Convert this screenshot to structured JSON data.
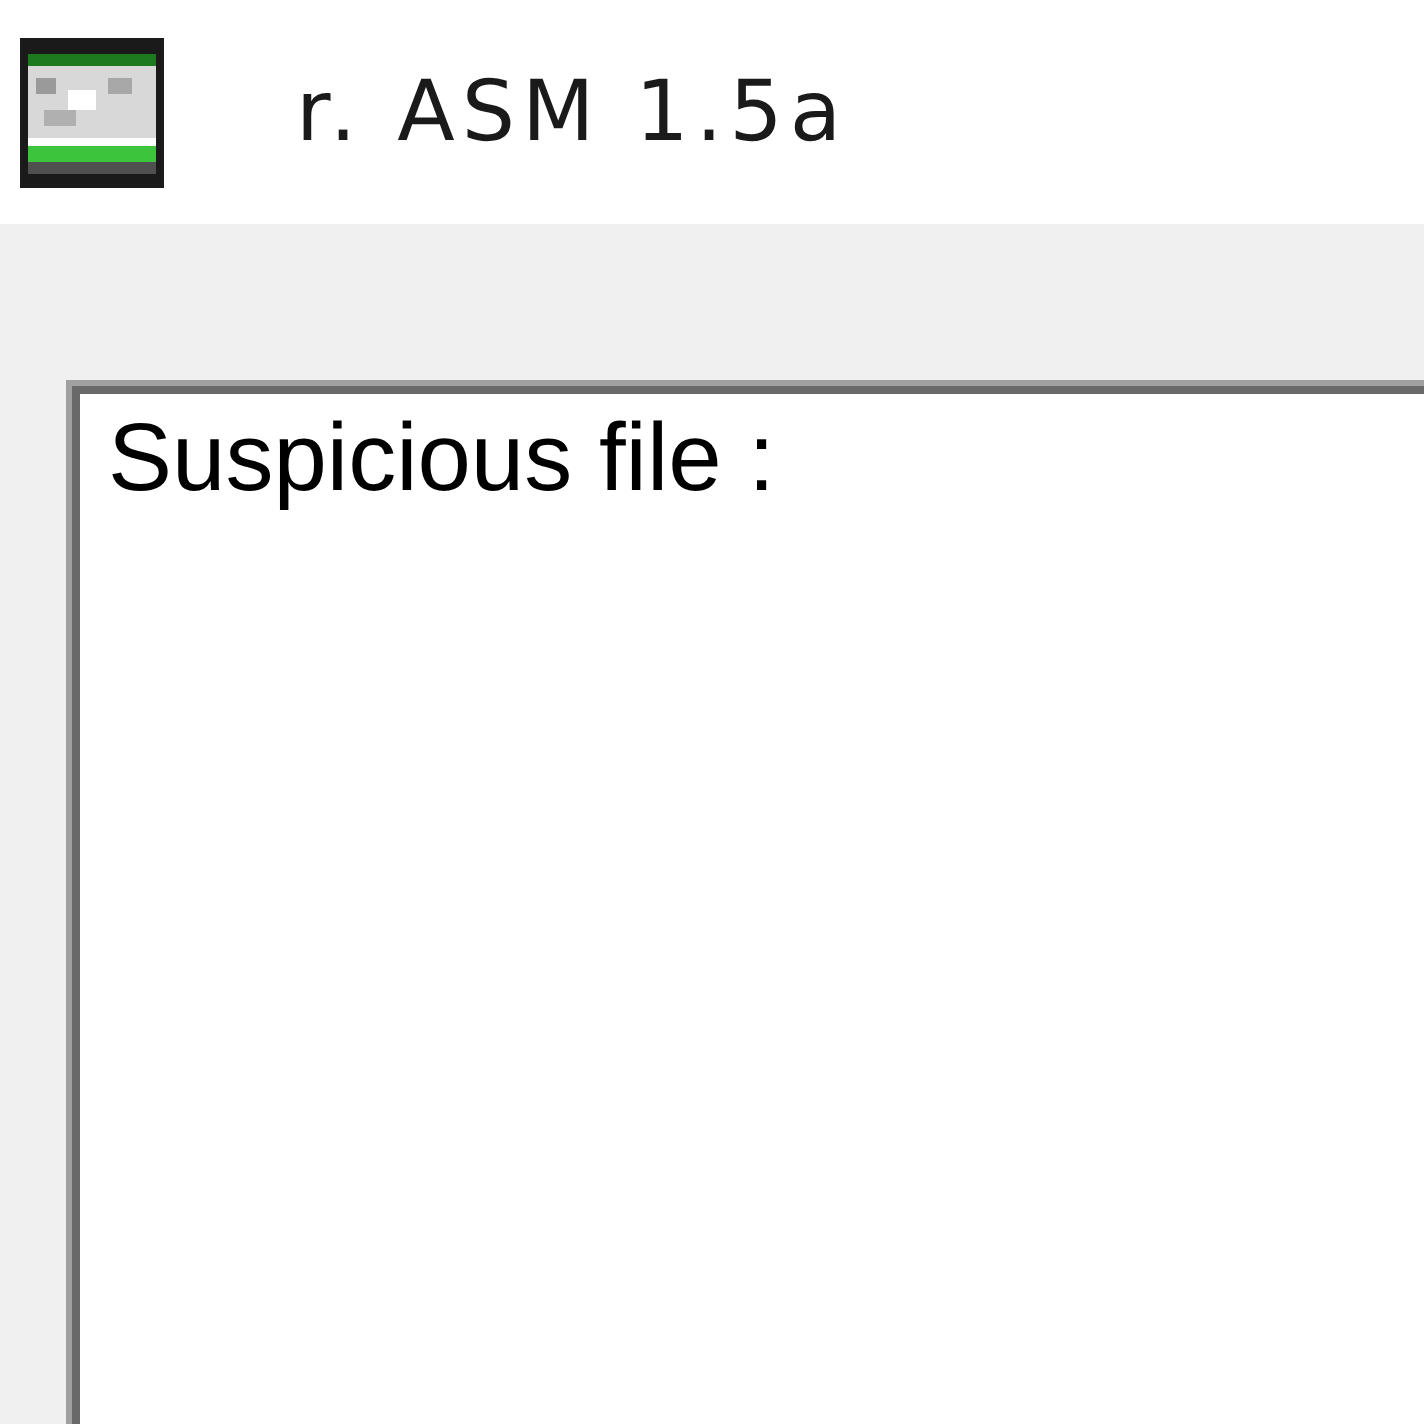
{
  "window": {
    "title": "r. ASM 1.5a"
  },
  "log": {
    "text": "Suspicious file :"
  }
}
